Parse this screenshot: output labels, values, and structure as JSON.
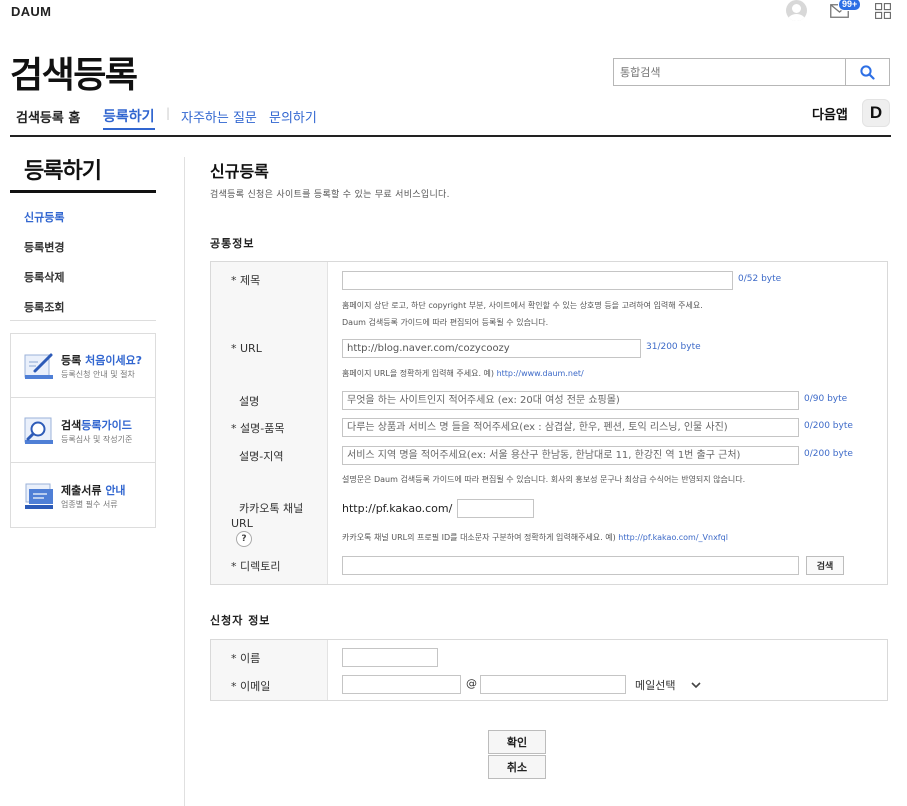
{
  "top_bar": {
    "logo": "DAUM",
    "mail_badge": "99+"
  },
  "header": {
    "title": "검색등록",
    "search_placeholder": "통합검색",
    "nav": {
      "home": "검색등록 홈",
      "register": "등록하기",
      "separator": "|",
      "faq": "자주하는 질문",
      "inquiry": "문의하기"
    },
    "daum_app": "다음앱",
    "daum_app_icon": "D"
  },
  "sidebar": {
    "title": "등록하기",
    "items": [
      "신규등록",
      "등록변경",
      "등록삭제",
      "등록조회"
    ],
    "promos": [
      {
        "icon": "pencil-doc-icon",
        "title_plain": "등록 ",
        "title_accent": "처음이세요?",
        "sub": "등록신청 안내 및 절차"
      },
      {
        "icon": "magnifier-doc-icon",
        "title_plain": "검색",
        "title_accent": "등록가이드",
        "sub": "등록심사 및 작성기준"
      },
      {
        "icon": "stacked-docs-icon",
        "title_plain": "제출서류 ",
        "title_accent": "안내",
        "sub": "업종별 필수 서류"
      }
    ]
  },
  "main": {
    "title": "신규등록",
    "description": "검색등록 신청은 사이트를 등록할 수 있는 무료 서비스입니다.",
    "common": {
      "section_title": "공통정보",
      "title_label": "* 제목",
      "title_value": "",
      "title_count": "0/52 byte",
      "title_note1": "홈페이지 상단 로고, 하단 copyright 부분, 사이트에서 확인할 수 있는 상호명 등을 고려하여 입력해 주세요.",
      "title_note2": "Daum 검색등록 가이드에 따라 편집되어 등록될 수 있습니다.",
      "url_label": "* URL",
      "url_value": "http://blog.naver.com/cozycoozy",
      "url_count": "31/200 byte",
      "url_note": "홈페이지 URL을 정확하게 입력해 주세요. 예) ",
      "url_note_link": "http://www.daum.net/",
      "desc_label": "설명",
      "desc_placeholder": "무엇을 하는 사이트인지 적어주세요 (ex: 20대 여성 전문 쇼핑몰)",
      "desc_count": "0/90 byte",
      "desc_item_label": "* 설명-품목",
      "desc_item_placeholder": "다루는 상품과 서비스 명 들을 적어주세요(ex : 삼겹살, 한우, 펜션, 토익 리스닝, 인물 사진)",
      "desc_item_count": "0/200 byte",
      "desc_region_label": "설명-지역",
      "desc_region_placeholder": "서비스 지역 명을 적어주세요(ex: 서울 용산구 한남동, 한남대로 11, 한강진 역 1번 출구 근처)",
      "desc_region_count": "0/200 byte",
      "desc_note": "설명문은 Daum 검색등록 가이드에 따라 편집될 수 있습니다. 회사의 홍보성 문구나 최상급 수식어는 반영되지 않습니다.",
      "kakao_label_1": "카카오톡 채널",
      "kakao_label_2": "URL",
      "kakao_help": "?",
      "kakao_prefix": "http://pf.kakao.com/",
      "kakao_value": "",
      "kakao_note": "카카오톡 채널 URL의 프로필 ID를 대소문자 구분하여 정확하게 입력해주세요. 예) ",
      "kakao_note_link": "http://pf.kakao.com/_Vnxfql",
      "dir_label": "* 디렉토리",
      "dir_value": "",
      "dir_button": "검색"
    },
    "applicant": {
      "section_title": "신청자 정보",
      "name_label": "* 이름",
      "name_value": "",
      "email_label": "* 이메일",
      "email_user": "",
      "at": "@",
      "email_domain": "",
      "email_select": "메일선택"
    },
    "confirm_button": "확인",
    "cancel_button": "취소"
  },
  "colors": {
    "accent": "#3166d0",
    "badge": "#2d6fe5",
    "text": "#222222"
  }
}
